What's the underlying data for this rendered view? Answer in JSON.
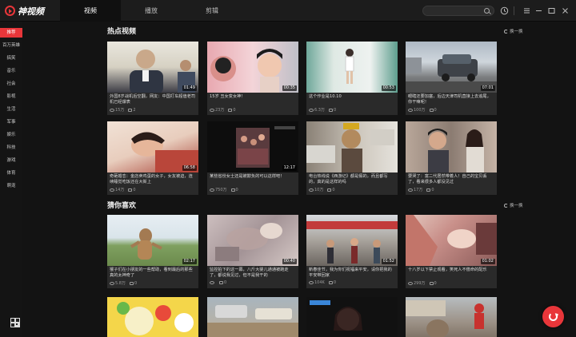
{
  "app": {
    "logo_text": "神视频"
  },
  "tabs": [
    {
      "label": "视频",
      "active": true
    },
    {
      "label": "播放",
      "active": false
    },
    {
      "label": "剪辑",
      "active": false
    }
  ],
  "search": {
    "placeholder": "",
    "value": ""
  },
  "window_controls": [
    "clock-icon",
    "menu-icon",
    "minimize-icon",
    "restore-icon",
    "close-icon"
  ],
  "sidebar": {
    "items": [
      {
        "label": "推荐",
        "active": true
      },
      {
        "label": "百万英雄",
        "active": false
      },
      {
        "label": "搞笑",
        "active": false
      },
      {
        "label": "音乐",
        "active": false
      },
      {
        "label": "社会",
        "active": false
      },
      {
        "label": "影视",
        "active": false
      },
      {
        "label": "生活",
        "active": false
      },
      {
        "label": "军事",
        "active": false
      },
      {
        "label": "娱乐",
        "active": false
      },
      {
        "label": "科技",
        "active": false
      },
      {
        "label": "游戏",
        "active": false
      },
      {
        "label": "体育",
        "active": false
      },
      {
        "label": "萌宠",
        "active": false
      }
    ]
  },
  "sections": {
    "hot": {
      "title": "热点视频",
      "refresh": "换一换"
    },
    "guess": {
      "title": "猜你喜欢",
      "refresh": "换一换"
    }
  },
  "hot_videos": [
    {
      "title": "外国8岁战机后空翻，网友：中国打车超值老司机已经爆表",
      "duration": "01:49",
      "views": "15万",
      "comments": "2"
    },
    {
      "title": "15岁 丑女变女神！",
      "duration": "00:35",
      "views": "23万",
      "comments": "0"
    },
    {
      "title": "这个作业是10.10",
      "duration": "00:53",
      "views": "6.3万",
      "comments": "0"
    },
    {
      "title": "眼瞎还要加塞，后边天津司机直接上去追尾，你干嘛呢！",
      "duration": "07:01",
      "views": "100万",
      "comments": "0"
    },
    {
      "title": "奇葩婚恋：金店卖鸡蛋的女子，女友被迫，连续睡觉吃饭还在大街上",
      "duration": "06:58",
      "views": "14万",
      "comments": "0"
    },
    {
      "title": "某些省份女士还是被欺负的可以这样吧！",
      "duration": "12:17",
      "views": "750万",
      "comments": "0"
    },
    {
      "title": "电台热线说《西游记》都是假的，而且都写的，真的是这样的吗",
      "duration": "",
      "views": "10万",
      "comments": "0"
    },
    {
      "title": "要哭了：富二代居然带着人！自己的宝贝丢了，看来很多人都没见过",
      "duration": "",
      "views": "17万",
      "comments": "0"
    }
  ],
  "guess_videos": [
    {
      "title": "猴子们在小朋友的一些帮助，看到最后的那些真的太神奇了",
      "duration": "02:17",
      "views": "5.8万",
      "comments": "0"
    },
    {
      "title": "监控拍下的这一幕，八斤大婴儿通通被跑走了，都说我见过，但不是我干的",
      "duration": "00:40",
      "views": "",
      "comments": "0"
    },
    {
      "title": "新春佳节，我为你们祝福来平安，请你把我的平安带回家",
      "duration": "01:52",
      "views": "104K",
      "comments": "0"
    },
    {
      "title": "十八岁以下禁止观看，笑死人不偿命的配乐",
      "duration": "01:02",
      "views": "299万",
      "comments": "0"
    },
    {
      "title": "",
      "duration": "",
      "views": "",
      "comments": ""
    },
    {
      "title": "",
      "duration": "",
      "views": "",
      "comments": ""
    },
    {
      "title": "",
      "duration": "",
      "views": "",
      "comments": ""
    },
    {
      "title": "",
      "duration": "",
      "views": "",
      "comments": ""
    }
  ],
  "colors": {
    "accent": "#e8363a",
    "background": "#131313",
    "card": "#2a2a2a",
    "topbar": "#1c1c1c"
  }
}
